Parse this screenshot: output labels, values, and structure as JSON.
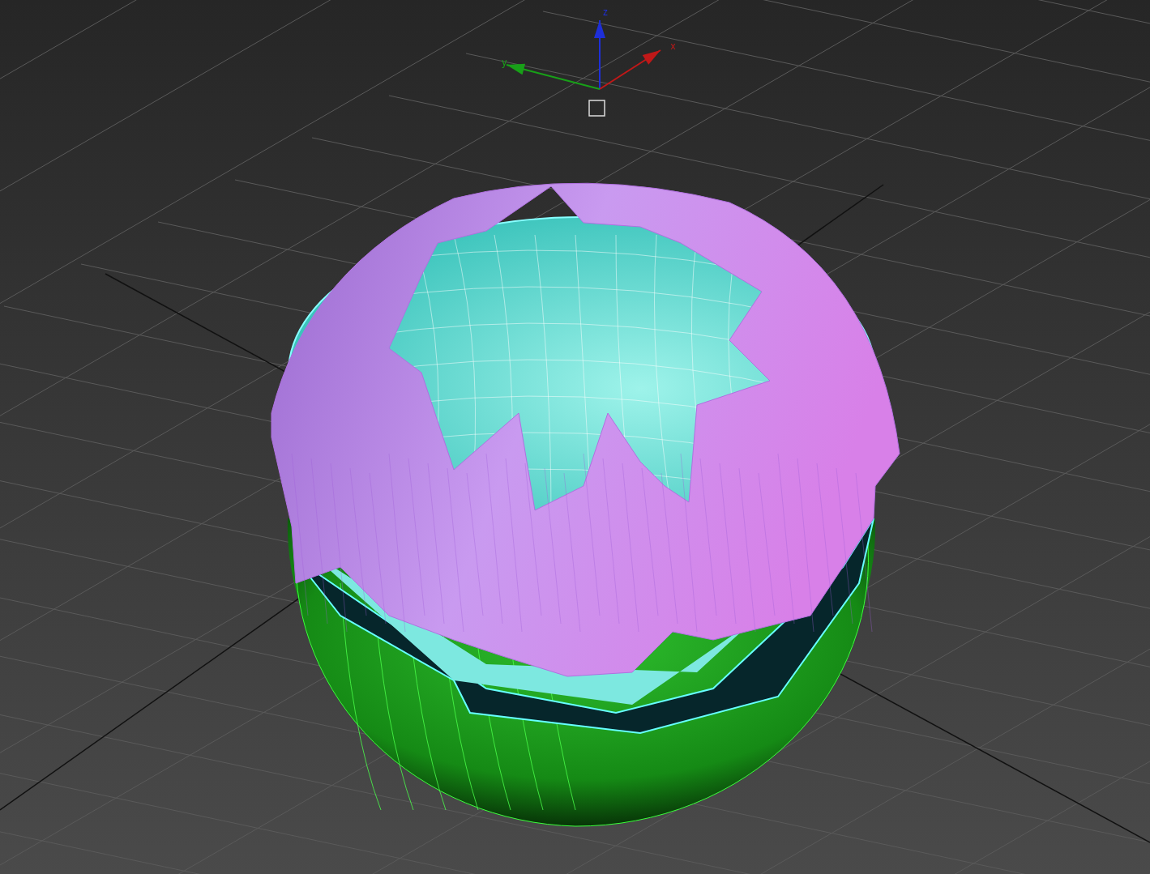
{
  "viewport": {
    "gizmo": {
      "axes": [
        {
          "label": "z",
          "color": "#1e2fd8"
        },
        {
          "label": "x",
          "color": "#c01818"
        },
        {
          "label": "y",
          "color": "#18a018"
        }
      ]
    }
  }
}
